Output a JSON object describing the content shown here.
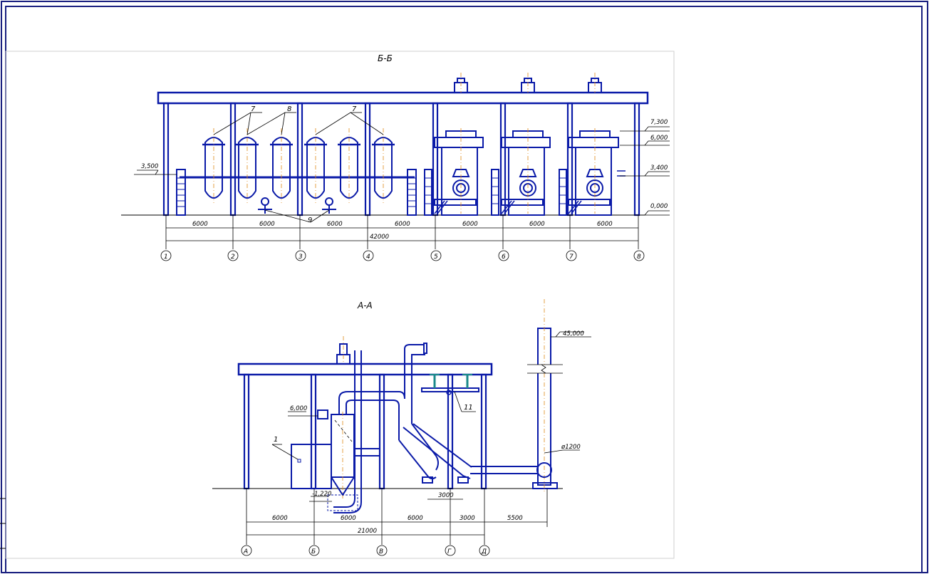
{
  "sections": {
    "bb": {
      "title": "Б-Б",
      "levels": [
        "7,300",
        "6,000",
        "3,400",
        "0,000"
      ],
      "left_level": "3,500",
      "dims": [
        "6000",
        "6000",
        "6000",
        "6000",
        "6000",
        "6000",
        "6000"
      ],
      "total": "42000",
      "axes": [
        "1",
        "2",
        "3",
        "4",
        "5",
        "6",
        "7",
        "8"
      ],
      "callouts": {
        "a": "7",
        "b": "8",
        "c": "7",
        "d": "9"
      }
    },
    "aa": {
      "title": "А-А",
      "level_top": "45,000",
      "level_mid": "6,000",
      "level_low": "-1,220",
      "diameter": "ø1200",
      "callout_1": "1",
      "callout_11": "11",
      "inner_dim": "3000",
      "dims": [
        "6000",
        "6000",
        "6000",
        "3000",
        "5500"
      ],
      "total": "21000",
      "axes": [
        "А",
        "Б",
        "В",
        "Г",
        "Д"
      ]
    }
  },
  "colors": {
    "line": "#0a1aa8",
    "axis": "#e08a1a",
    "frame": "#1a2080"
  }
}
